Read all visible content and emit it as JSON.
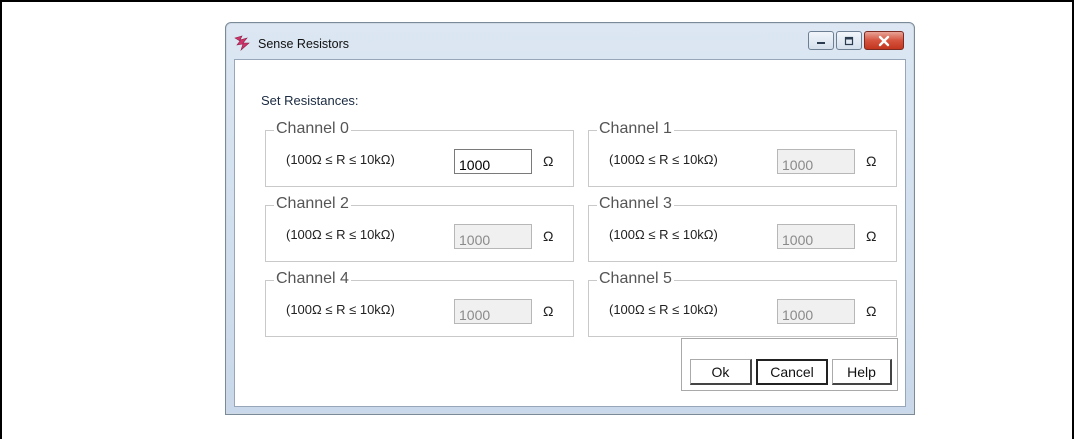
{
  "window": {
    "title": "Sense Resistors",
    "section_label": "Set Resistances:"
  },
  "channels": [
    {
      "title": "Channel 0",
      "range": "(100Ω ≤ R ≤ 10kΩ)",
      "value": "1000",
      "unit": "Ω",
      "enabled": true
    },
    {
      "title": "Channel 1",
      "range": "(100Ω ≤ R ≤ 10kΩ)",
      "value": "1000",
      "unit": "Ω",
      "enabled": false
    },
    {
      "title": "Channel 2",
      "range": "(100Ω ≤ R ≤ 10kΩ)",
      "value": "1000",
      "unit": "Ω",
      "enabled": false
    },
    {
      "title": "Channel 3",
      "range": "(100Ω ≤ R ≤ 10kΩ)",
      "value": "1000",
      "unit": "Ω",
      "enabled": false
    },
    {
      "title": "Channel 4",
      "range": "(100Ω ≤ R ≤ 10kΩ)",
      "value": "1000",
      "unit": "Ω",
      "enabled": false
    },
    {
      "title": "Channel 5",
      "range": "(100Ω ≤ R ≤ 10kΩ)",
      "value": "1000",
      "unit": "Ω",
      "enabled": false
    }
  ],
  "buttons": {
    "ok": "Ok",
    "cancel": "Cancel",
    "help": "Help"
  },
  "icons": {
    "app": "app-logo-icon",
    "minimize": "minimize-icon",
    "maximize": "maximize-icon",
    "close": "close-icon"
  },
  "colors": {
    "close_button": "#d5533e",
    "title_bar": "#dce7f3",
    "app_icon": "#d0336a"
  }
}
